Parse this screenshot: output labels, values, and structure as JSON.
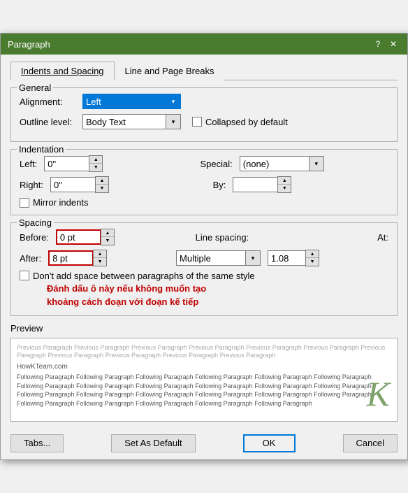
{
  "dialog": {
    "title": "Paragraph",
    "help_btn": "?",
    "close_btn": "✕"
  },
  "tabs": [
    {
      "id": "indents-spacing",
      "label": "Indents and Spacing",
      "active": true
    },
    {
      "id": "line-page-breaks",
      "label": "Line and Page Breaks",
      "active": false
    }
  ],
  "general": {
    "section_title": "General",
    "alignment_label": "Alignment:",
    "alignment_value": "Left",
    "outline_label": "Outline level:",
    "outline_value": "Body Text",
    "collapsed_label": "Collapsed by default"
  },
  "indentation": {
    "section_title": "Indentation",
    "left_label": "Left:",
    "left_value": "0\"",
    "right_label": "Right:",
    "right_value": "0\"",
    "special_label": "Special:",
    "special_value": "(none)",
    "by_label": "By:",
    "by_value": "",
    "mirror_label": "Mirror indents"
  },
  "spacing": {
    "section_title": "Spacing",
    "before_label": "Before:",
    "before_value": "0 pt",
    "after_label": "After:",
    "after_value": "8 pt",
    "line_spacing_label": "Line spacing:",
    "line_spacing_value": "Multiple",
    "at_label": "At:",
    "at_value": "1.08",
    "same_style_label": "Don't add space between paragraphs of the same style",
    "annotation": "Đánh dấu ô này nếu không muốn tạo\nkhoảng cách đoạn với đoạn kế tiếp"
  },
  "preview": {
    "section_title": "Preview",
    "prev_para": "Previous Paragraph Previous Paragraph Previous Paragraph Previous Paragraph Previous Paragraph Previous Paragraph Previous Paragraph Previous Paragraph Previous Paragraph Previous Paragraph Previous Paragraph",
    "site_name": "HowKTeam.com",
    "follow_para": "Following Paragraph Following Paragraph Following Paragraph Following Paragraph Following Paragraph Following Paragraph Following Paragraph Following Paragraph Following Paragraph Following Paragraph Following Paragraph Following Paragraph Following Paragraph Following Paragraph Following Paragraph Following Paragraph Following Paragraph Following Paragraph Following Paragraph Following Paragraph Following Paragraph Following Paragraph Following Paragraph"
  },
  "buttons": {
    "tabs_label": "Tabs...",
    "set_default_label": "Set As Default",
    "ok_label": "OK",
    "cancel_label": "Cancel"
  },
  "icons": {
    "dropdown_arrow": "▾",
    "spinner_up": "▲",
    "spinner_down": "▼"
  }
}
